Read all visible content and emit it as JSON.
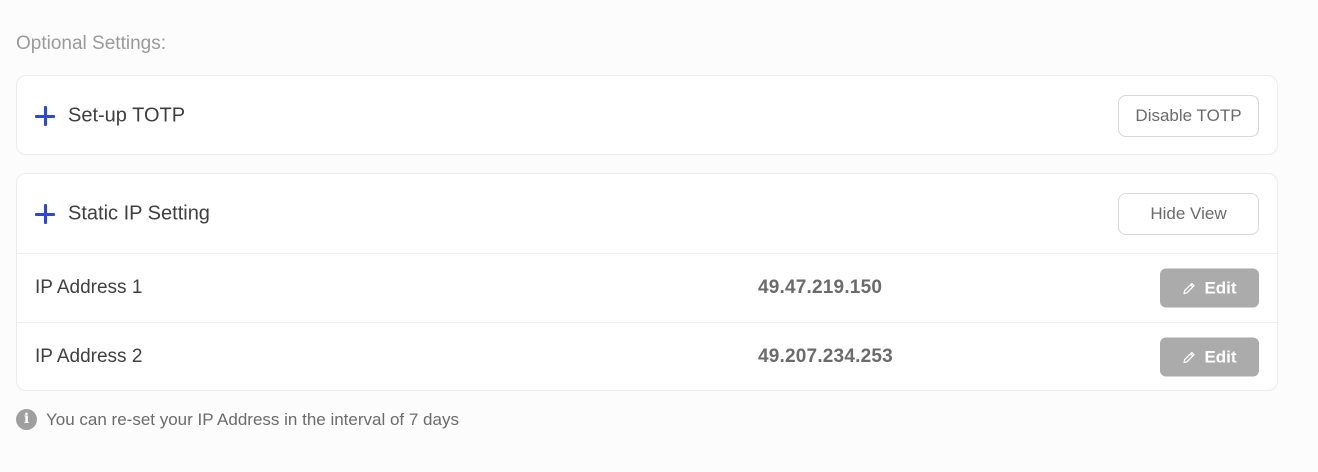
{
  "optional_settings": {
    "title": "Optional Settings:"
  },
  "totp": {
    "title": "Set-up TOTP",
    "button_label": "Disable TOTP",
    "icon": "plus-icon"
  },
  "static_ip": {
    "title": "Static IP Setting",
    "button_label": "Hide View",
    "icon": "plus-icon",
    "rows": [
      {
        "label": "IP Address 1",
        "value": "49.47.219.150",
        "edit_label": "Edit"
      },
      {
        "label": "IP Address 2",
        "value": "49.207.234.253",
        "edit_label": "Edit"
      }
    ]
  },
  "note": {
    "icon": "info-icon",
    "icon_glyph": "i",
    "text": "You can re-set your IP Address in the interval of 7 days"
  },
  "colors": {
    "accent": "#2f46d6",
    "edit_button_bg": "#ababab",
    "muted_text": "#9a9a9a"
  }
}
